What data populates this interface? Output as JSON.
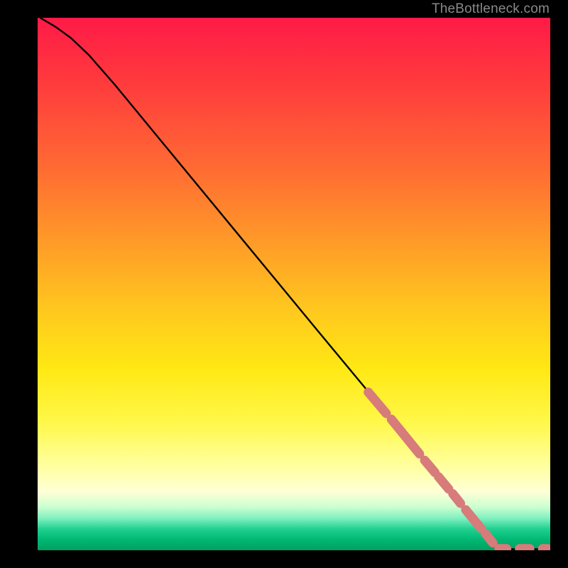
{
  "attribution": "TheBottleneck.com",
  "chart_data": {
    "type": "line",
    "title": "",
    "xlabel": "",
    "ylabel": "",
    "xlim": [
      0,
      100
    ],
    "ylim": [
      0,
      100
    ],
    "grid": false,
    "legend": false,
    "series": [
      {
        "name": "curve",
        "style": "solid-black",
        "points": [
          {
            "x": 0.5,
            "y": 100.0
          },
          {
            "x": 3.5,
            "y": 98.3
          },
          {
            "x": 6.5,
            "y": 96.2
          },
          {
            "x": 10.0,
            "y": 93.0
          },
          {
            "x": 15.0,
            "y": 87.5
          },
          {
            "x": 25.0,
            "y": 75.8
          },
          {
            "x": 40.0,
            "y": 58.3
          },
          {
            "x": 55.0,
            "y": 40.8
          },
          {
            "x": 65.0,
            "y": 29.2
          },
          {
            "x": 75.0,
            "y": 17.5
          },
          {
            "x": 85.0,
            "y": 5.8
          },
          {
            "x": 89.0,
            "y": 1.2
          },
          {
            "x": 90.5,
            "y": 0.2
          },
          {
            "x": 93.0,
            "y": 0.2
          },
          {
            "x": 96.5,
            "y": 0.2
          },
          {
            "x": 99.5,
            "y": 0.2
          }
        ]
      },
      {
        "name": "pink-dashed-overlay",
        "style": "dashed-pink-thick",
        "segments": [
          {
            "x1": 64.5,
            "y1": 29.7,
            "x2": 68.0,
            "y2": 25.7
          },
          {
            "x1": 69.0,
            "y1": 24.6,
            "x2": 74.5,
            "y2": 18.1
          },
          {
            "x1": 75.5,
            "y1": 16.9,
            "x2": 77.5,
            "y2": 14.6
          },
          {
            "x1": 78.2,
            "y1": 13.8,
            "x2": 80.2,
            "y2": 11.5
          },
          {
            "x1": 81.0,
            "y1": 10.6,
            "x2": 82.5,
            "y2": 8.8
          },
          {
            "x1": 83.5,
            "y1": 7.6,
            "x2": 86.5,
            "y2": 4.1
          },
          {
            "x1": 87.3,
            "y1": 3.2,
            "x2": 88.8,
            "y2": 1.4
          },
          {
            "x1": 90.0,
            "y1": 0.3,
            "x2": 91.5,
            "y2": 0.3
          },
          {
            "x1": 94.0,
            "y1": 0.3,
            "x2": 96.0,
            "y2": 0.3
          },
          {
            "x1": 98.5,
            "y1": 0.3,
            "x2": 99.5,
            "y2": 0.3
          }
        ]
      }
    ]
  }
}
